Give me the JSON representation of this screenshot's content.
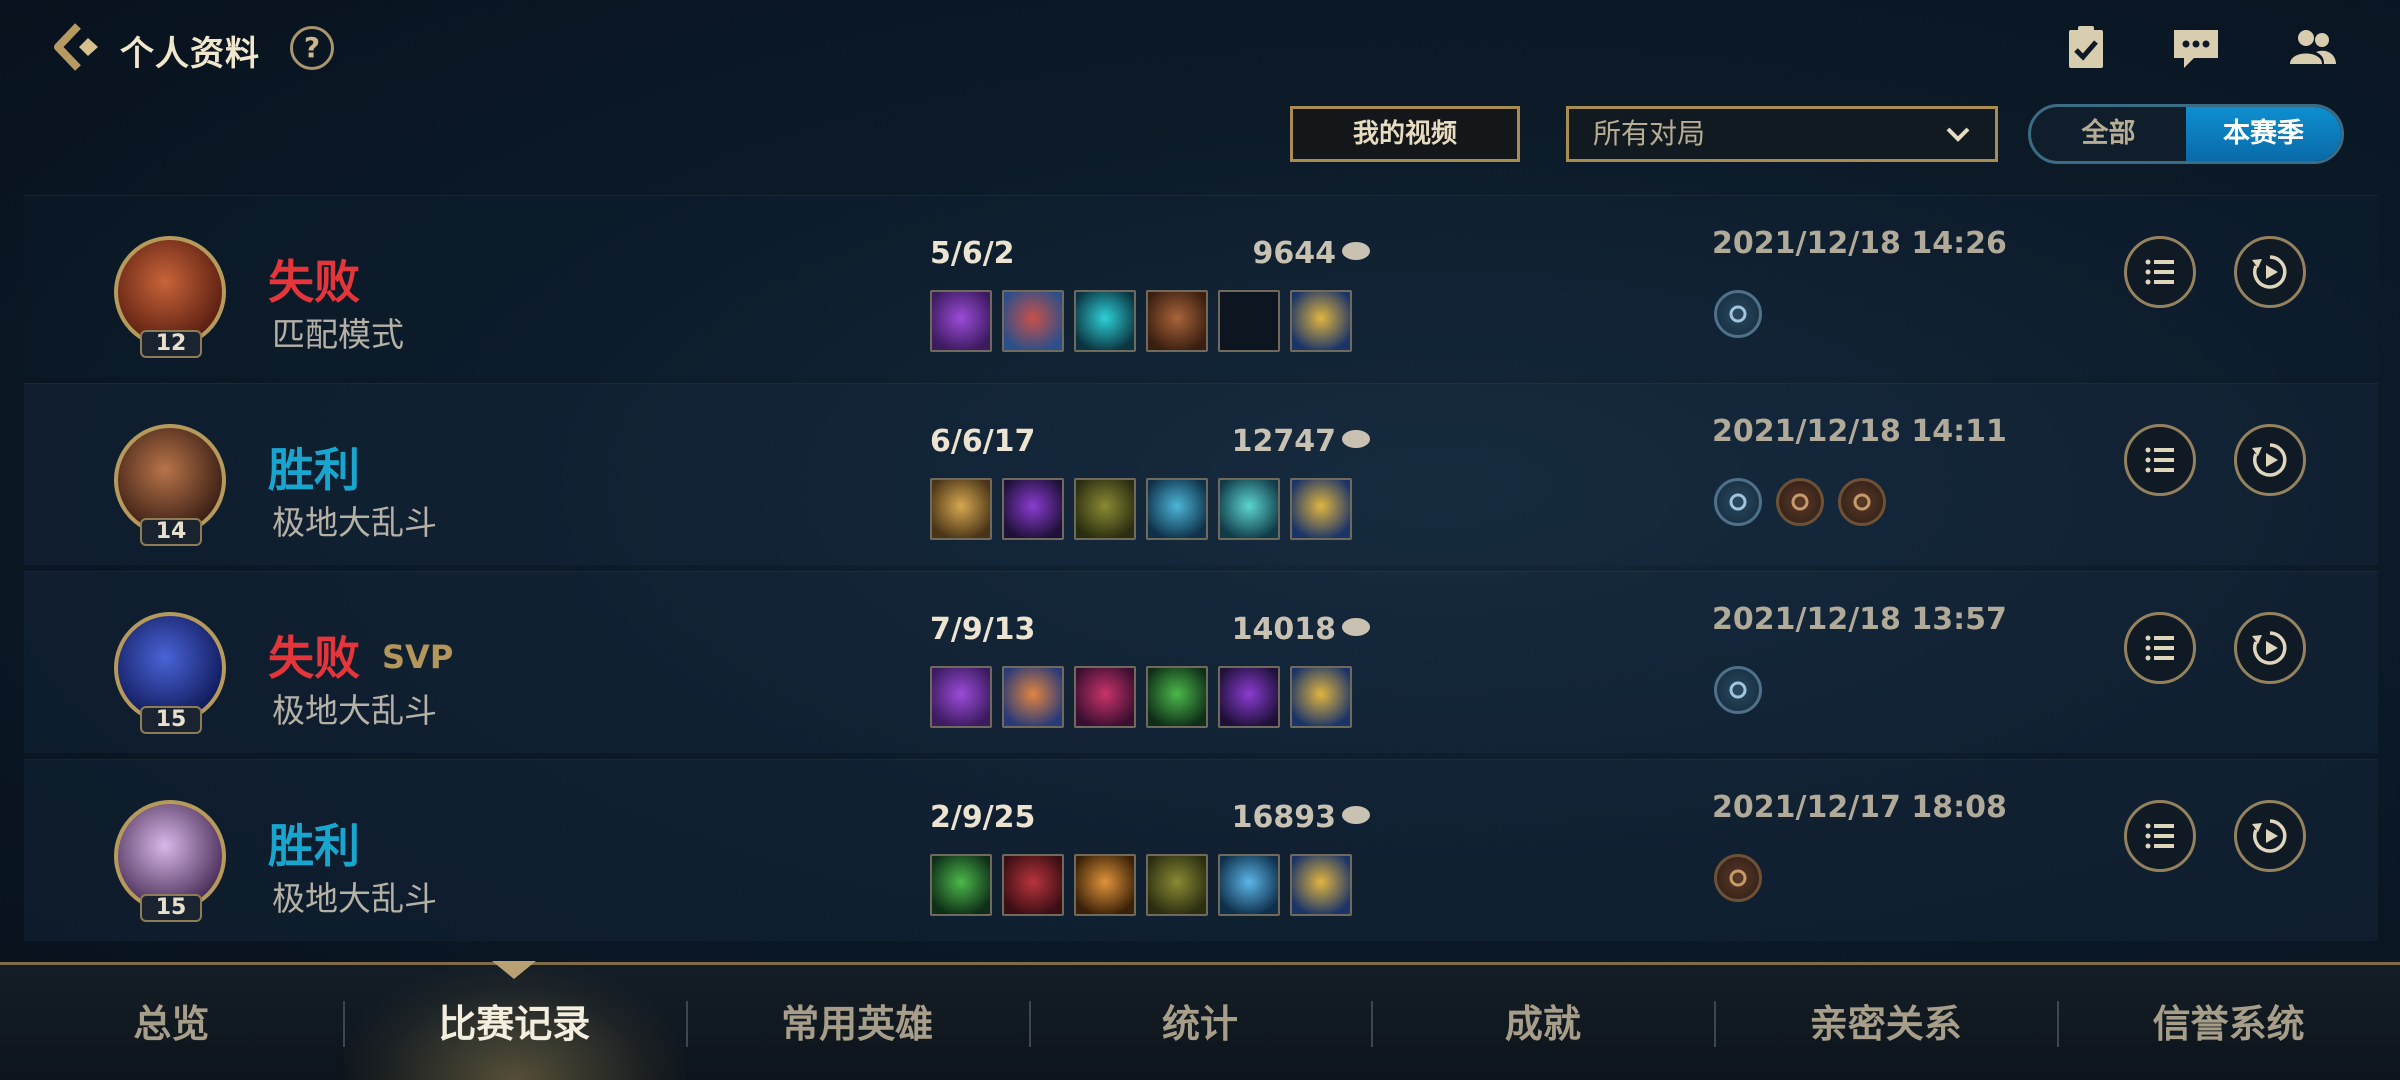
{
  "header": {
    "title": "个人资料",
    "help_label": "?",
    "icons": [
      "checklist-icon",
      "chat-icon",
      "friends-icon"
    ]
  },
  "filters": {
    "video_button": "我的视频",
    "match_select_value": "所有对局",
    "segment_all": "全部",
    "segment_season": "本赛季",
    "segment_selected": "本赛季"
  },
  "matches": [
    {
      "result": "失败",
      "result_type": "lose",
      "svp": "",
      "mode": "匹配模式",
      "level": "12",
      "kda": "5/6/2",
      "gold": "9644",
      "date": "2021/12/18 14:26",
      "items": [
        "purple",
        "blue-red",
        "cyan",
        "brown",
        "empty",
        "gold-blue"
      ],
      "badges": [
        "blue"
      ]
    },
    {
      "result": "胜利",
      "result_type": "win",
      "svp": "",
      "mode": "极地大乱斗",
      "level": "14",
      "kda": "6/6/17",
      "gold": "12747",
      "date": "2021/12/18 14:11",
      "items": [
        "gold",
        "violet",
        "olive",
        "teal",
        "aqua",
        "gold-blue"
      ],
      "badges": [
        "blue",
        "bronze",
        "bronze"
      ]
    },
    {
      "result": "失败",
      "result_type": "lose",
      "svp": "SVP",
      "mode": "极地大乱斗",
      "level": "15",
      "kda": "7/9/13",
      "gold": "14018",
      "date": "2021/12/18 13:57",
      "items": [
        "purple",
        "orange-blue",
        "magenta",
        "green",
        "violet",
        "gold-blue"
      ],
      "badges": [
        "blue"
      ]
    },
    {
      "result": "胜利",
      "result_type": "win",
      "svp": "",
      "mode": "极地大乱斗",
      "level": "15",
      "kda": "2/9/25",
      "gold": "16893",
      "date": "2021/12/17 18:08",
      "items": [
        "green",
        "crimson",
        "amber",
        "olive",
        "sky",
        "gold-blue"
      ],
      "badges": [
        "bronze"
      ]
    }
  ],
  "nav": {
    "tabs": [
      "总览",
      "比赛记录",
      "常用英雄",
      "统计",
      "成就",
      "亲密关系",
      "信誉系统"
    ],
    "active": "比赛记录"
  },
  "colors": {
    "lose": "#e4353b",
    "win": "#18a6cf",
    "accent_gold": "#a88c52",
    "segment_active": "#0e8fd0"
  }
}
